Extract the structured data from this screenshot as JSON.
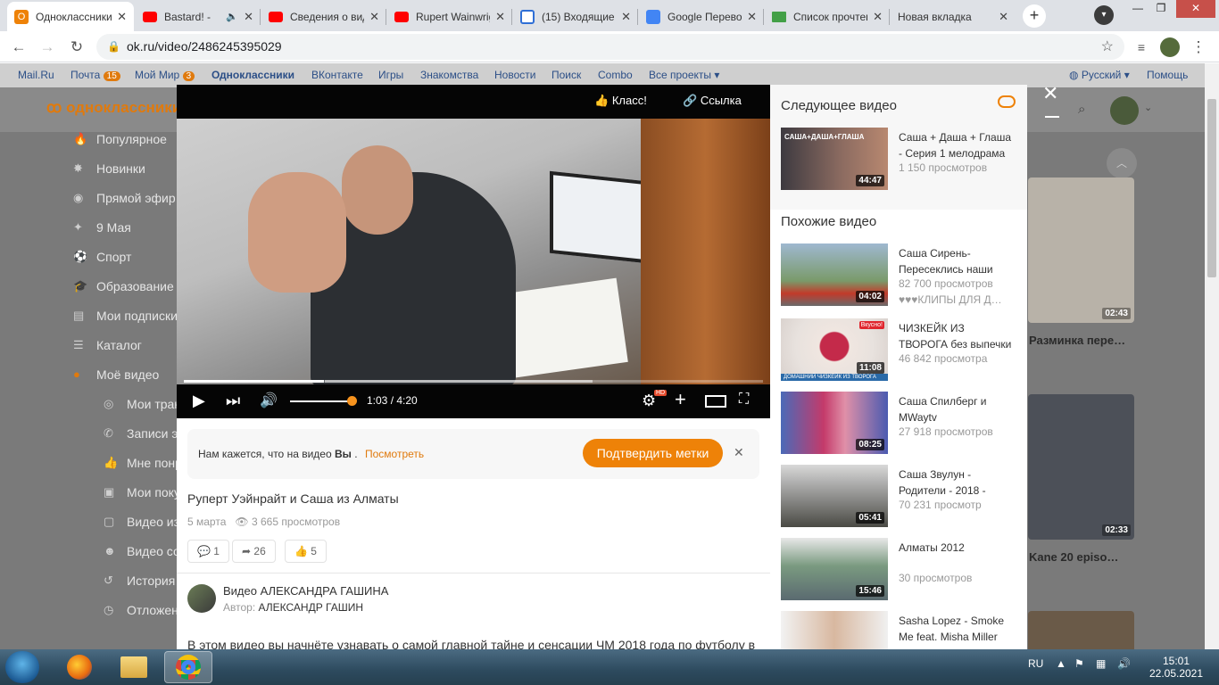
{
  "browser": {
    "tabs": [
      {
        "title": "Одноклассники",
        "active": true,
        "favicon_color": "#ee8208"
      },
      {
        "title": "Bastard! -",
        "favicon_color": "#ff0000",
        "audio": true
      },
      {
        "title": "Сведения о видео",
        "favicon_color": "#ff0000"
      },
      {
        "title": "Rupert Wainwright",
        "favicon_color": "#ff0000"
      },
      {
        "title": "(15) Входящие",
        "favicon_color": "#2f6fd6"
      },
      {
        "title": "Google Переводчик",
        "favicon_color": "#4285f4"
      },
      {
        "title": "Список прочтения",
        "favicon_color": "#43a047"
      },
      {
        "title": "Новая вкладка",
        "favicon_color": ""
      }
    ],
    "url": "ok.ru/video/2486245395029"
  },
  "portal_nav": {
    "items": [
      "Mail.Ru",
      "Почта",
      "Мой Мир",
      "Одноклассники",
      "ВКонтакте",
      "Игры",
      "Знакомства",
      "Новости",
      "Поиск",
      "Combo",
      "Все проекты ▾"
    ],
    "pochta_badge": "15",
    "mir_badge": "3",
    "language": "Русский ▾",
    "help": "Помощь"
  },
  "site": {
    "logo": "одноклассники"
  },
  "left_menu": {
    "items": [
      "Популярное",
      "Новинки",
      "Прямой эфир",
      "9 Мая",
      "Спорт",
      "Образование",
      "Мои подписки",
      "Каталог",
      "Моё видео"
    ],
    "sub_items": [
      "Мои трансляции",
      "Записи эфиров",
      "Мне понравилось",
      "Мои покупки",
      "Видео из сообщений",
      "Видео со мной",
      "История",
      "Отложенные"
    ]
  },
  "background_cards": {
    "titles": [
      "Разминка пере…",
      "Kane 20 episo…"
    ],
    "durations": [
      "02:43",
      "02:33"
    ]
  },
  "player": {
    "klass_label": "Класс!",
    "link_label": "Ссылка",
    "time_current": "1:03",
    "time_total": "4:20",
    "time_display": "1:03 / 4:20",
    "progress_fraction": 0.242,
    "volume_fraction": 0.9,
    "hd_badge": "HD"
  },
  "notice": {
    "text_prefix": "Нам кажется, что на видео",
    "text_bold": "Вы",
    "text_suffix": ".",
    "link": "Посмотреть",
    "confirm_button": "Подтвердить метки"
  },
  "video": {
    "title": "Руперт Уэйнрайт и Саша из Алматы",
    "date": "5 марта",
    "views": "3 665 просмотров",
    "comments": "1",
    "shares": "26",
    "likes": "5"
  },
  "channel": {
    "name": "Видео АЛЕКСАНДРА ГАШИНА",
    "author_label": "Автор:",
    "author_name": "АЛЕКСАНДР ГАШИН"
  },
  "description": "В этом видео вы начнёте узнавать о самой главной тайне и сенсации ЧМ 2018 года по футболу в",
  "sidebar": {
    "next_title": "Следующее видео",
    "next_video": {
      "name": "Саша + Даша + Глаша - Серия 1 мелодрама",
      "views": "1 150 просмотров",
      "duration": "44:47",
      "thumb_caption": "САША+ДАША+ГЛАША"
    },
    "similar_title": "Похожие видео",
    "similar": [
      {
        "name": "Саша Сирень- Пересеклись наши",
        "views": "82 700 просмотров",
        "extra": "♥♥♥КЛИПЫ ДЛЯ Д…",
        "duration": "04:02"
      },
      {
        "name": "ЧИЗКЕЙК ИЗ ТВОРОГА без выпечки",
        "views": "46 842 просмотра",
        "duration": "11:08",
        "thumb_caption": "ДОМАШНИЙ ЧИЗКЕЙК ИЗ ТВОРОГА",
        "thumb_badge": "Вкусно!"
      },
      {
        "name": "Саша Спилберг и MWaytv",
        "views": "27 918 просмотров",
        "duration": "08:25"
      },
      {
        "name": "Саша Звулун - Родители - 2018 -",
        "views": "70 231 просмотр",
        "duration": "05:41"
      },
      {
        "name": "Алматы 2012",
        "views": "30 просмотров",
        "duration": "15:46"
      },
      {
        "name": "Sasha Lopez - Smoke Me feat. Misha Miller",
        "views": "",
        "duration": ""
      }
    ]
  },
  "taskbar": {
    "lang": "RU",
    "time": "15:01",
    "date": "22.05.2021"
  },
  "colors": {
    "accent": "#ee8208",
    "link": "#e07a0d",
    "portal_link": "#2c4f87"
  }
}
